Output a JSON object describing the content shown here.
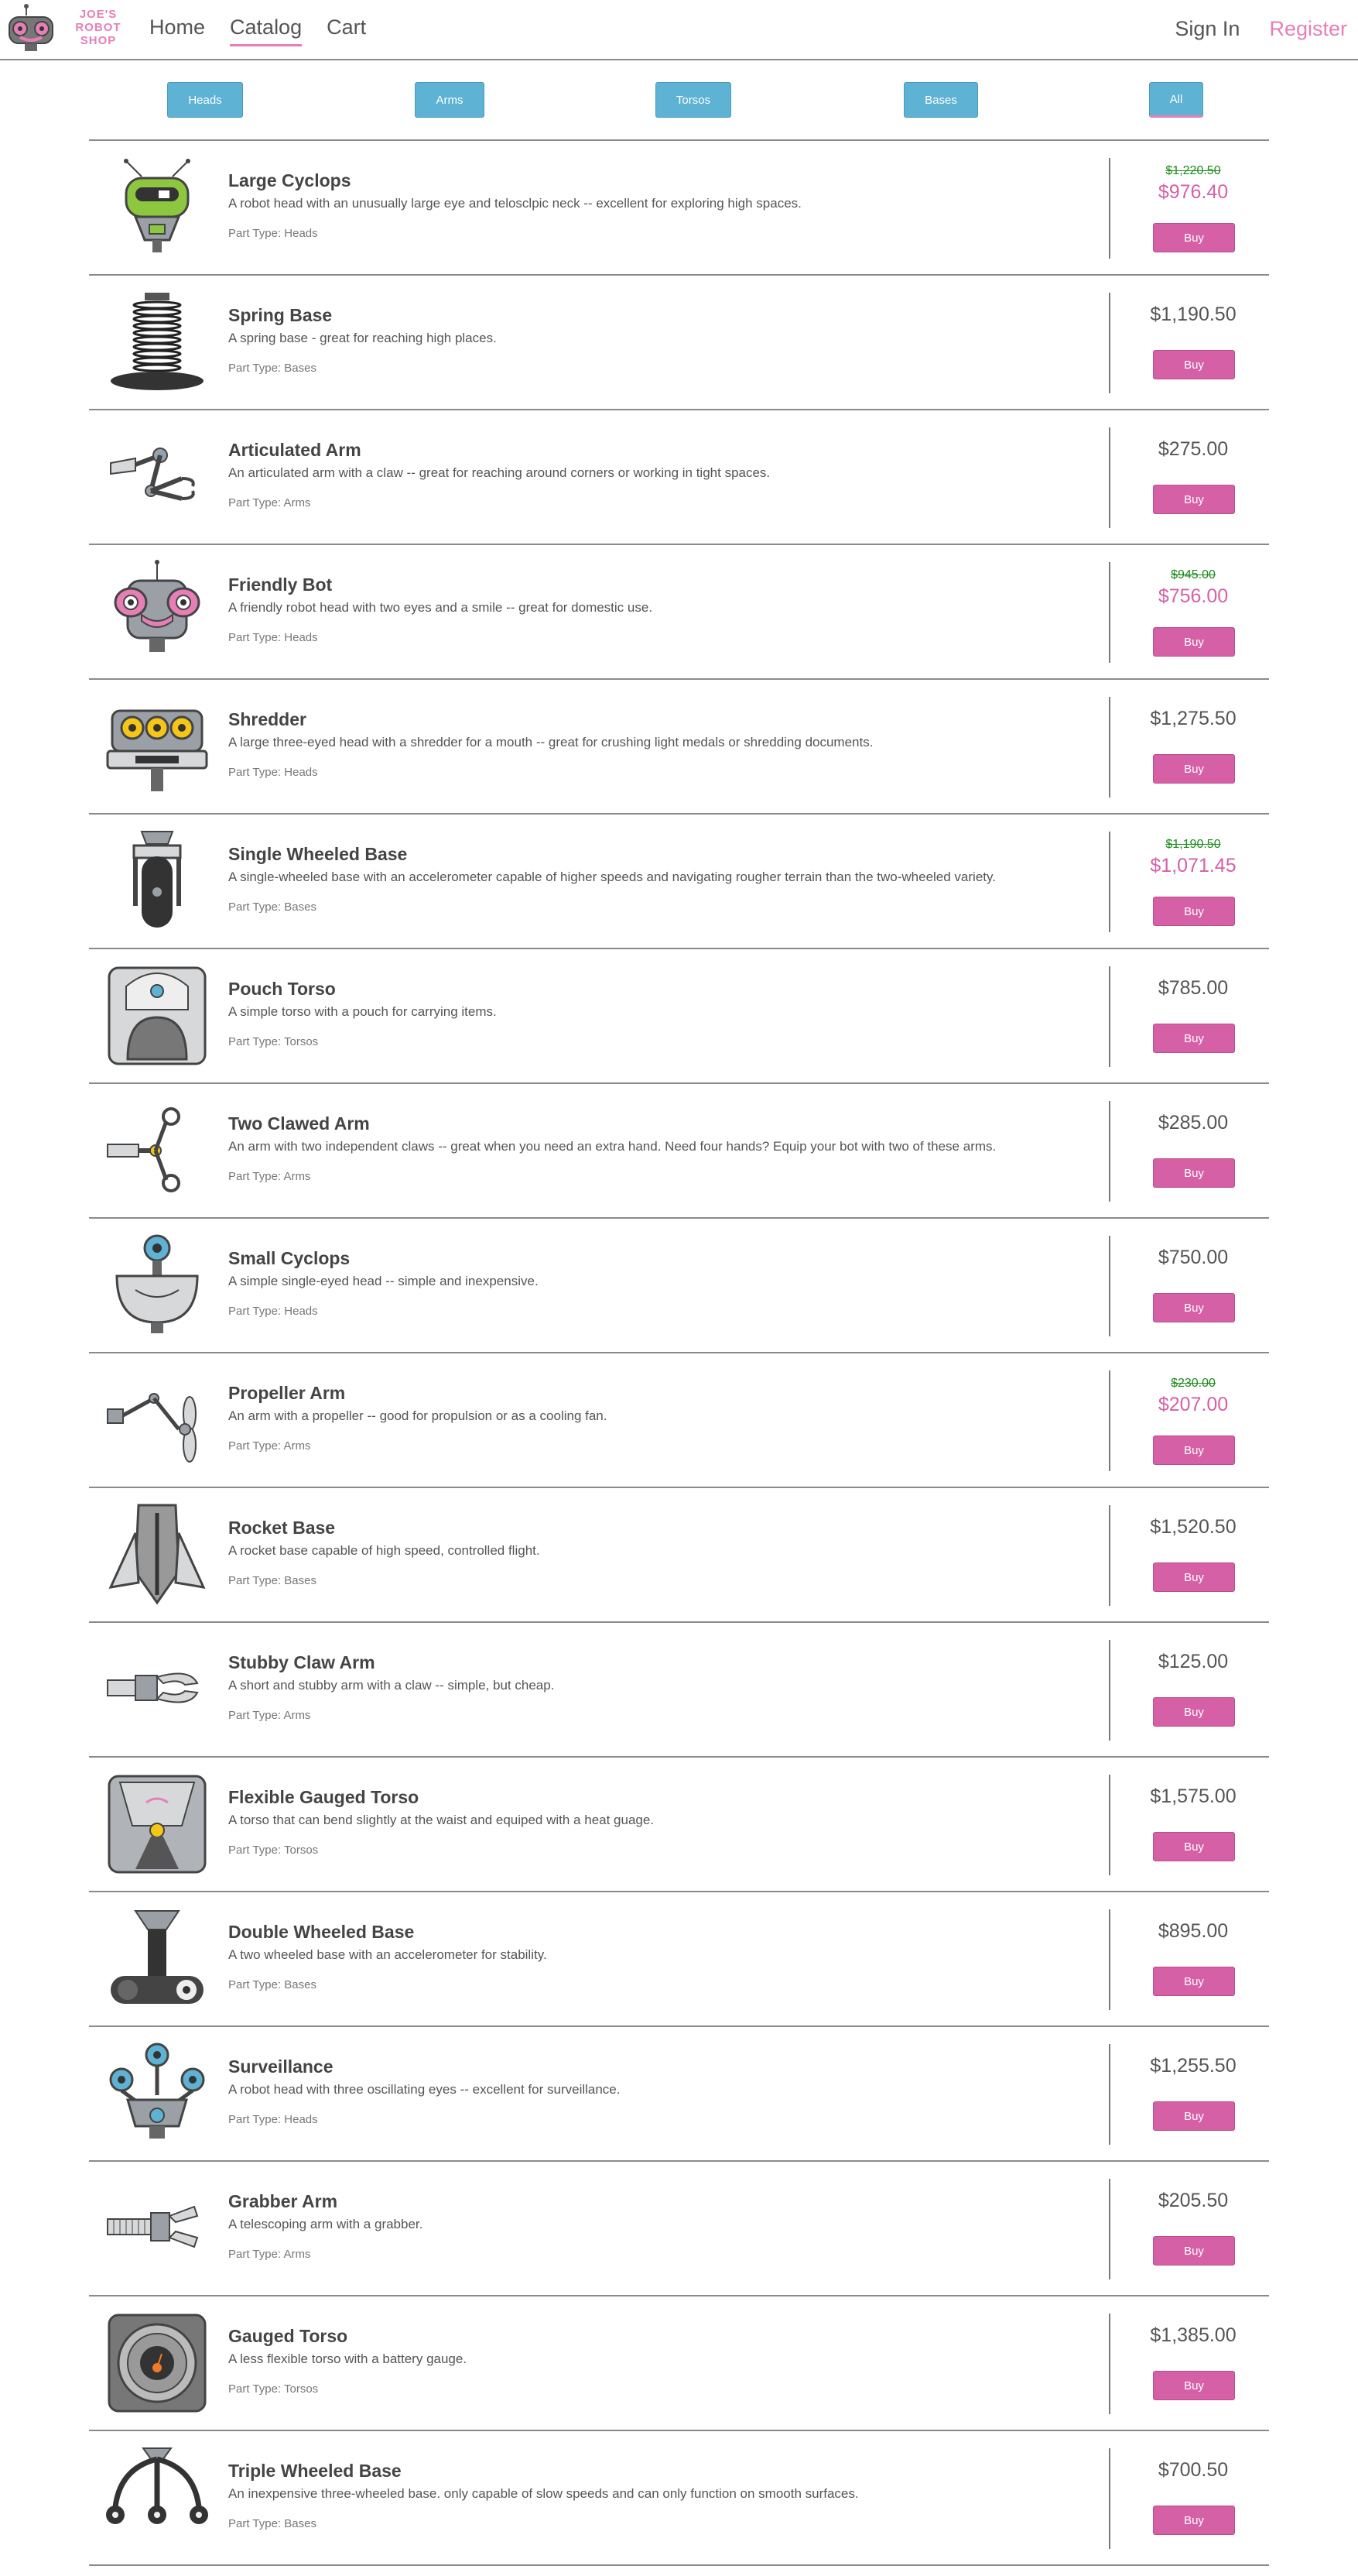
{
  "header": {
    "logo_text": [
      "JOE'S",
      "ROBOT",
      "SHOP"
    ],
    "nav": [
      "Home",
      "Catalog",
      "Cart"
    ],
    "active_nav": "Catalog",
    "sign_in": "Sign In",
    "register": "Register"
  },
  "filters": {
    "buttons": [
      "Heads",
      "Arms",
      "Torsos",
      "Bases",
      "All"
    ],
    "active": "All"
  },
  "buy_label": "Buy",
  "part_type_prefix": "Part Type: ",
  "colors": {
    "accent_pink": "#d660a6",
    "filter_blue": "#5eb2d4",
    "sale_green": "#1d8a1d"
  },
  "products": [
    {
      "title": "Large Cyclops",
      "desc": "A robot head with an unusually large eye and telosclpic neck -- excellent for exploring high spaces.",
      "type": "Heads",
      "price": "$1,220.50",
      "sale": "$976.40",
      "icon": "large-cyclops-head-icon"
    },
    {
      "title": "Spring Base",
      "desc": "A spring base - great for reaching high places.",
      "type": "Bases",
      "price": "$1,190.50",
      "sale": null,
      "icon": "spring-base-icon"
    },
    {
      "title": "Articulated Arm",
      "desc": "An articulated arm with a claw -- great for reaching around corners or working in tight spaces.",
      "type": "Arms",
      "price": "$275.00",
      "sale": null,
      "icon": "articulated-arm-icon"
    },
    {
      "title": "Friendly Bot",
      "desc": "A friendly robot head with two eyes and a smile -- great for domestic use.",
      "type": "Heads",
      "price": "$945.00",
      "sale": "$756.00",
      "icon": "friendly-bot-head-icon"
    },
    {
      "title": "Shredder",
      "desc": "A large three-eyed head with a shredder for a mouth -- great for crushing light medals or shredding documents.",
      "type": "Heads",
      "price": "$1,275.50",
      "sale": null,
      "icon": "shredder-head-icon"
    },
    {
      "title": "Single Wheeled Base",
      "desc": "A single-wheeled base with an accelerometer capable of higher speeds and navigating rougher terrain than the two-wheeled variety.",
      "type": "Bases",
      "price": "$1,190.50",
      "sale": "$1,071.45",
      "icon": "single-wheel-base-icon"
    },
    {
      "title": "Pouch Torso",
      "desc": "A simple torso with a pouch for carrying items.",
      "type": "Torsos",
      "price": "$785.00",
      "sale": null,
      "icon": "pouch-torso-icon"
    },
    {
      "title": "Two Clawed Arm",
      "desc": "An arm with two independent claws -- great when you need an extra hand. Need four hands? Equip your bot with two of these arms.",
      "type": "Arms",
      "price": "$285.00",
      "sale": null,
      "icon": "two-clawed-arm-icon"
    },
    {
      "title": "Small Cyclops",
      "desc": "A simple single-eyed head -- simple and inexpensive.",
      "type": "Heads",
      "price": "$750.00",
      "sale": null,
      "icon": "small-cyclops-head-icon"
    },
    {
      "title": "Propeller Arm",
      "desc": "An arm with a propeller -- good for propulsion or as a cooling fan.",
      "type": "Arms",
      "price": "$230.00",
      "sale": "$207.00",
      "icon": "propeller-arm-icon"
    },
    {
      "title": "Rocket Base",
      "desc": "A rocket base capable of high speed, controlled flight.",
      "type": "Bases",
      "price": "$1,520.50",
      "sale": null,
      "icon": "rocket-base-icon"
    },
    {
      "title": "Stubby Claw Arm",
      "desc": "A short and stubby arm with a claw -- simple, but cheap.",
      "type": "Arms",
      "price": "$125.00",
      "sale": null,
      "icon": "stubby-claw-arm-icon"
    },
    {
      "title": "Flexible Gauged Torso",
      "desc": "A torso that can bend slightly at the waist and equiped with a heat guage.",
      "type": "Torsos",
      "price": "$1,575.00",
      "sale": null,
      "icon": "flexible-gauged-torso-icon"
    },
    {
      "title": "Double Wheeled Base",
      "desc": "A two wheeled base with an accelerometer for stability.",
      "type": "Bases",
      "price": "$895.00",
      "sale": null,
      "icon": "double-wheel-base-icon"
    },
    {
      "title": "Surveillance",
      "desc": "A robot head with three oscillating eyes -- excellent for surveillance.",
      "type": "Heads",
      "price": "$1,255.50",
      "sale": null,
      "icon": "surveillance-head-icon"
    },
    {
      "title": "Grabber Arm",
      "desc": "A telescoping arm with a grabber.",
      "type": "Arms",
      "price": "$205.50",
      "sale": null,
      "icon": "grabber-arm-icon"
    },
    {
      "title": "Gauged Torso",
      "desc": "A less flexible torso with a battery gauge.",
      "type": "Torsos",
      "price": "$1,385.00",
      "sale": null,
      "icon": "gauged-torso-icon"
    },
    {
      "title": "Triple Wheeled Base",
      "desc": "An inexpensive three-wheeled base. only capable of slow speeds and can only function on smooth surfaces.",
      "type": "Bases",
      "price": "$700.50",
      "sale": null,
      "icon": "triple-wheel-base-icon"
    }
  ]
}
